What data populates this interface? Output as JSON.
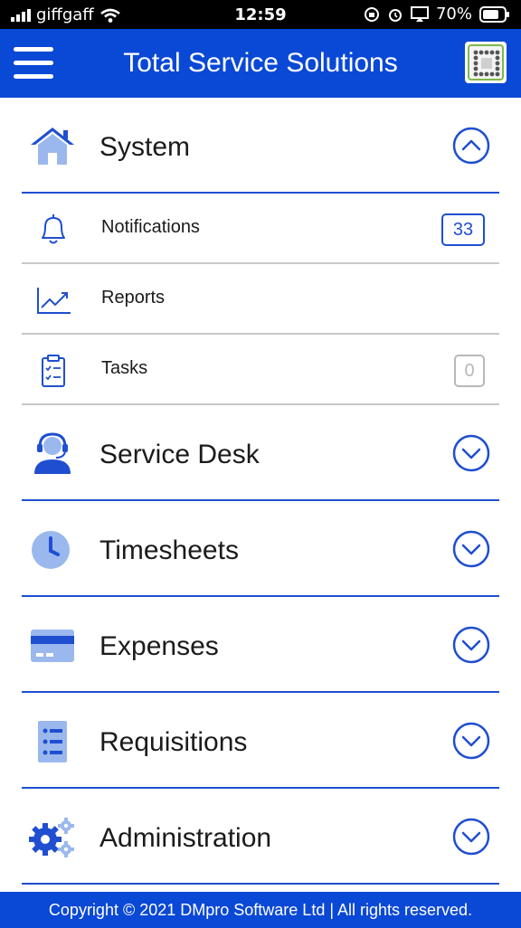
{
  "status_bar": {
    "carrier": "giffgaff",
    "time": "12:59",
    "battery": "70%"
  },
  "header": {
    "title": "Total Service Solutions",
    "menu_icon": "hamburger-menu-icon",
    "logo_icon": "dmpro-logo-icon"
  },
  "system": {
    "label": "System",
    "expanded": true,
    "items": [
      {
        "label": "Notifications",
        "icon": "bell-icon",
        "badge": "33"
      },
      {
        "label": "Reports",
        "icon": "trend-chart-icon",
        "badge": ""
      },
      {
        "label": "Tasks",
        "icon": "clipboard-icon",
        "badge": "0"
      }
    ]
  },
  "sections": [
    {
      "label": "Service Desk",
      "icon": "headset-user-icon"
    },
    {
      "label": "Timesheets",
      "icon": "clock-icon"
    },
    {
      "label": "Expenses",
      "icon": "credit-card-icon"
    },
    {
      "label": "Requisitions",
      "icon": "list-document-icon"
    },
    {
      "label": "Administration",
      "icon": "gears-icon"
    }
  ],
  "footer": {
    "text": "Copyright © 2021 DMpro Software Ltd | All rights reserved."
  },
  "colors": {
    "brand_blue": "#0a48d6",
    "accent_blue": "#1f4fd0",
    "icon_light_blue": "#9bb8ee"
  }
}
